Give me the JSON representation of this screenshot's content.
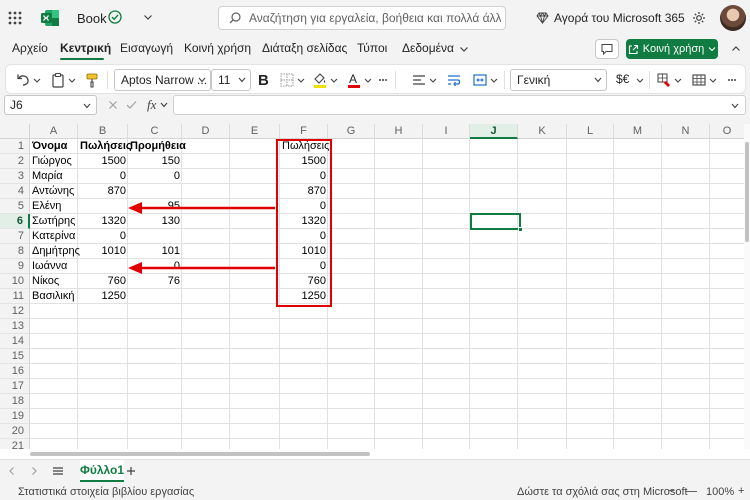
{
  "app": {
    "book_title": "Book",
    "search_placeholder": "Αναζήτηση για εργαλεία, βοήθεια και πολλά άλλα (Alt",
    "buy_label": "Αγορά του Microsoft 365"
  },
  "menu": {
    "tabs": [
      "Αρχείο",
      "Κεντρική",
      "Εισαγωγή",
      "Κοινή χρήση",
      "Διάταξη σελίδας",
      "Τύποι",
      "Δεδομένα"
    ],
    "share_label": "Κοινή χρήση"
  },
  "ribbon": {
    "font_name": "Aptos Narrow ...",
    "font_size": "11",
    "number_format": "Γενική",
    "currency_symbol": "$€"
  },
  "formula_bar": {
    "name_box": "J6",
    "fx_label": "fx",
    "formula_value": ""
  },
  "grid": {
    "columns": [
      "A",
      "B",
      "C",
      "D",
      "E",
      "F",
      "G",
      "H",
      "I",
      "J",
      "K",
      "L",
      "M",
      "N",
      "O"
    ],
    "selected_column": "J",
    "rows": [
      "1",
      "2",
      "3",
      "4",
      "5",
      "6",
      "7",
      "8",
      "9",
      "10",
      "11",
      "12",
      "13",
      "14",
      "15",
      "16",
      "17",
      "18",
      "19",
      "20",
      "21"
    ],
    "selected_row": "6",
    "col_a": [
      "Όνομα",
      "Γιώργος",
      "Μαρία",
      "Αντώνης",
      "Ελένη",
      "Σωτήρης",
      "Κατερίνα",
      "Δημήτρης",
      "Ιωάννα",
      "Νίκος",
      "Βασιλική"
    ],
    "col_b": [
      "Πωλήσεις",
      "1500",
      "0",
      "870",
      "",
      "1320",
      "0",
      "1010",
      "",
      "760",
      "1250"
    ],
    "col_c": [
      "Προμήθεια",
      "150",
      "0",
      "",
      "95",
      "130",
      "",
      "101",
      "0",
      "76",
      ""
    ],
    "col_f": [
      "Πωλήσεις",
      "1500",
      "0",
      "870",
      "0",
      "1320",
      "0",
      "1010",
      "0",
      "760",
      "1250"
    ]
  },
  "sheets": {
    "active_sheet": "Φύλλο1"
  },
  "status": {
    "left_text": "Στατιστικά στοιχεία βιβλίου εργασίας",
    "right_text": "Δώστε τα σχόλιά σας στη Microsoft",
    "zoom": "100%"
  },
  "colors": {
    "accent": "#107c41",
    "annotation": "#e00000"
  }
}
